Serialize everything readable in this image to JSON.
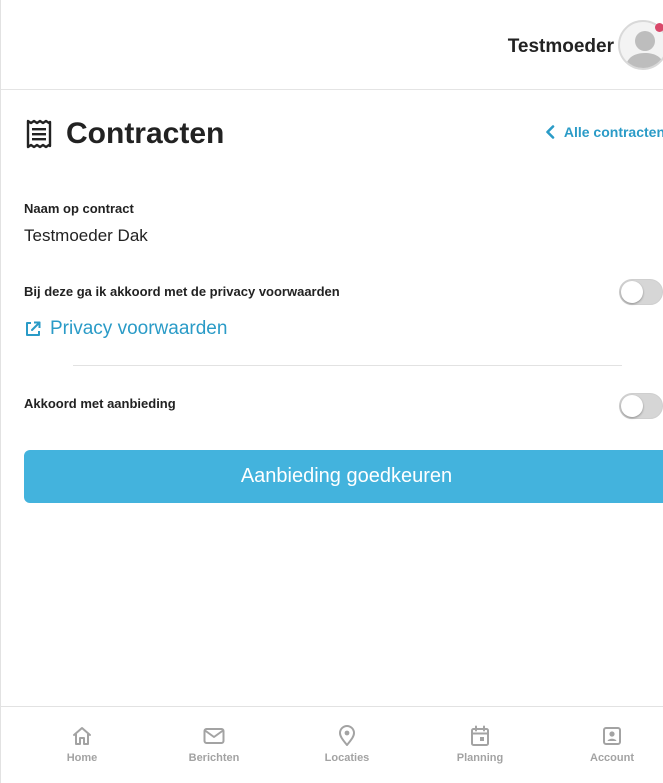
{
  "header": {
    "user_name": "Testmoeder",
    "avatar_icon": "user-avatar-icon"
  },
  "page": {
    "title": "Contracten",
    "title_icon": "receipt-icon",
    "back_label": "Alle contracten"
  },
  "contract": {
    "name_label": "Naam op contract",
    "name_value": "Testmoeder Dak",
    "privacy_label": "Bij deze ga ik akkoord met de privacy voorwaarden",
    "privacy_toggle_on": false,
    "privacy_link": "Privacy voorwaarden",
    "offer_label": "Akkoord met aanbieding",
    "offer_toggle_on": false,
    "approve_button": "Aanbieding goedkeuren"
  },
  "nav": {
    "items": [
      {
        "label": "Home",
        "icon": "home-icon"
      },
      {
        "label": "Berichten",
        "icon": "mail-icon"
      },
      {
        "label": "Locaties",
        "icon": "location-pin-icon"
      },
      {
        "label": "Planning",
        "icon": "calendar-icon"
      },
      {
        "label": "Account",
        "icon": "account-icon"
      }
    ]
  },
  "colors": {
    "accent": "#2a9bc7",
    "button": "#43b3dd",
    "notification": "#d9486a",
    "nav_inactive": "#a3a3a3"
  }
}
